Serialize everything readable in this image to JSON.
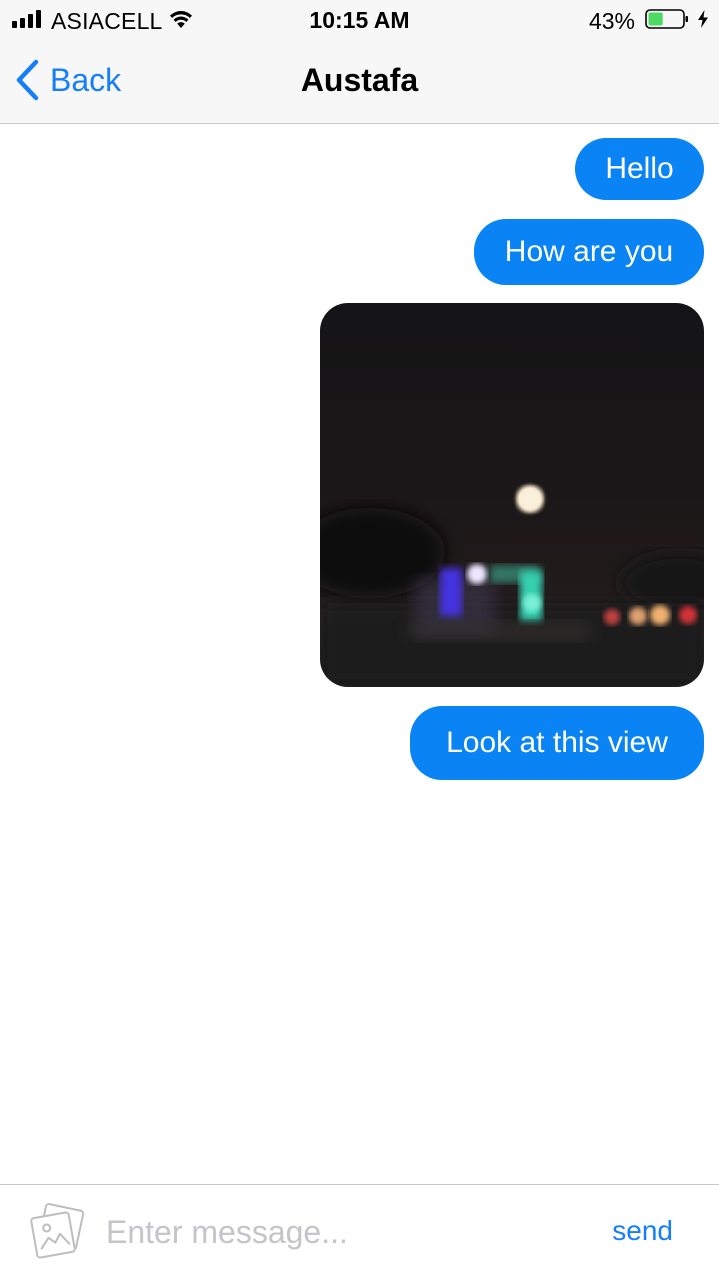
{
  "status_bar": {
    "carrier": "ASIACELL",
    "time": "10:15 AM",
    "battery_percent": "43%",
    "signal_icon": "signal-bars-icon",
    "wifi_icon": "wifi-icon",
    "battery_icon": "battery-icon",
    "charging_icon": "charging-bolt-icon",
    "battery_level": 0.43,
    "battery_color": "#4cd964"
  },
  "nav": {
    "back_label": "Back",
    "back_icon": "chevron-left-icon",
    "title": "Austafa",
    "accent_color": "#147efb"
  },
  "messages": [
    {
      "type": "text",
      "direction": "outgoing",
      "text": "Hello"
    },
    {
      "type": "text",
      "direction": "outgoing",
      "text": "How are you"
    },
    {
      "type": "image",
      "direction": "outgoing",
      "subject": "night-sky-moon-photo"
    },
    {
      "type": "text",
      "direction": "outgoing",
      "text": "Look at this view"
    }
  ],
  "bubble_color": "#0a84f5",
  "composer": {
    "attach_icon": "photo-gallery-icon",
    "placeholder": "Enter message...",
    "value": "",
    "send_label": "send"
  }
}
